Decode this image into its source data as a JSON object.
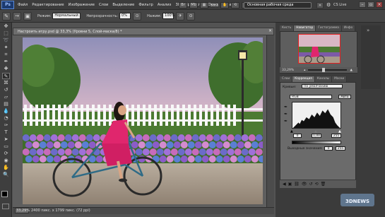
{
  "app": {
    "logo": "Ps",
    "zoom_display": "33,3",
    "workspace_button": "Основная рабочая среда",
    "cs_live": "CS Live"
  },
  "menu": [
    "Файл",
    "Редактирование",
    "Изображение",
    "Слои",
    "Выделение",
    "Фильтр",
    "Анализ",
    "3D",
    "Просмотр",
    "Окно",
    "Справка"
  ],
  "options": {
    "mode_label": "Режим:",
    "mode_value": "Нормальный",
    "opacity_label": "Непрозрачность:",
    "opacity_value": "0%",
    "flow_label": "Нажим:",
    "flow_value": "100%"
  },
  "document": {
    "tab_title": "Настроить игру.psd @ 33,3% (Уровни 5, Слой-маска/8) *",
    "status_zoom": "33,29%",
    "status_info": "2400 пикс. x 1799 пикс. (72 ppi)"
  },
  "panels": {
    "top_tabs": [
      "Кисть",
      "Навигатор",
      "Гистограмма",
      "Инфо"
    ],
    "active_top_tab": "Навигатор",
    "nav_zoom": "33,29%",
    "adj_tabs": [
      "Слои",
      "Коррекция",
      "Каналы",
      "Маски"
    ],
    "active_adj_tab": "Коррекция",
    "levels_label": "Кривые:",
    "levels_preset": "По умолчанию",
    "channel": "RGB",
    "auto_button": "Авто",
    "input_values": [
      "0",
      "1,00",
      "255"
    ],
    "output_label": "Выходные значения:",
    "output_values": [
      "0",
      "255"
    ]
  },
  "colors": {
    "accent": "#2d5fb0",
    "pink_dress": "#e0266d"
  }
}
